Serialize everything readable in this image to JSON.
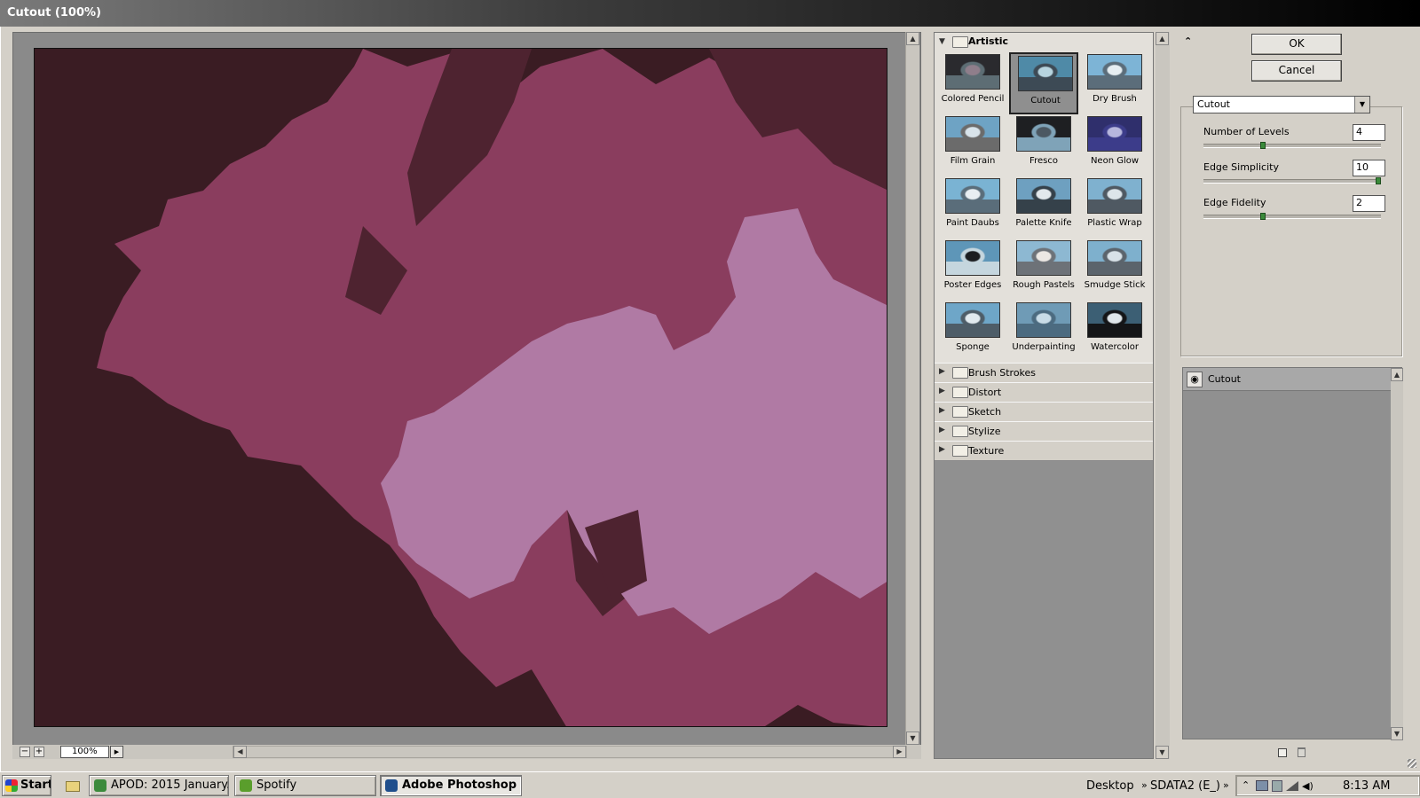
{
  "window": {
    "title": "Cutout (100%)"
  },
  "preview": {
    "zoom": "100%",
    "zoom_out_icon": "minus",
    "zoom_in_icon": "plus",
    "zoom_menu_icon": "triangle-right"
  },
  "gallery": {
    "expanded_category": "Artistic",
    "filters": [
      {
        "label": "Colored Pencil",
        "colors": [
          "#2a2a2e",
          "#8f7e8b",
          "#5d6d74"
        ]
      },
      {
        "label": "Cutout",
        "selected": true,
        "colors": [
          "#4f8aa7",
          "#b7d4df",
          "#3d4a55"
        ]
      },
      {
        "label": "Dry Brush",
        "colors": [
          "#7db4d6",
          "#e6eef2",
          "#5b6d7a"
        ]
      },
      {
        "label": "Film Grain",
        "colors": [
          "#6ea3c4",
          "#d8e3ea",
          "#6b6b6b"
        ]
      },
      {
        "label": "Fresco",
        "colors": [
          "#1e1f22",
          "#4c5862",
          "#7fa3b8"
        ]
      },
      {
        "label": "Neon Glow",
        "colors": [
          "#2f2f6c",
          "#b7b7dd",
          "#3c3c8a"
        ]
      },
      {
        "label": "Paint Daubs",
        "colors": [
          "#7ab3d3",
          "#e8eef2",
          "#5a6d7a"
        ]
      },
      {
        "label": "Palette Knife",
        "colors": [
          "#6ea0c0",
          "#e2e8ec",
          "#35414a"
        ]
      },
      {
        "label": "Plastic Wrap",
        "colors": [
          "#7fb1cf",
          "#dde5ea",
          "#4f5962"
        ]
      },
      {
        "label": "Poster Edges",
        "colors": [
          "#5e96b8",
          "#1b1d20",
          "#c5d6de"
        ]
      },
      {
        "label": "Rough Pastels",
        "colors": [
          "#8db8d2",
          "#ece8e4",
          "#6d7278"
        ]
      },
      {
        "label": "Smudge Stick",
        "colors": [
          "#7eb0cd",
          "#d8e2e8",
          "#5b646c"
        ]
      },
      {
        "label": "Sponge",
        "colors": [
          "#6ea6c8",
          "#e1eaef",
          "#4e5d68"
        ]
      },
      {
        "label": "Underpainting",
        "colors": [
          "#6f9bb6",
          "#c9dce7",
          "#4c6b80"
        ]
      },
      {
        "label": "Watercolor",
        "colors": [
          "#3c5f74",
          "#dfe6ea",
          "#141517"
        ]
      }
    ],
    "categories": [
      "Brush Strokes",
      "Distort",
      "Sketch",
      "Stylize",
      "Texture"
    ]
  },
  "settings": {
    "ok_label": "OK",
    "cancel_label": "Cancel",
    "collapse_icon": "double-chevron-up",
    "selected_filter": "Cutout",
    "params": [
      {
        "label": "Number of Levels",
        "value": "4",
        "position": 0.33
      },
      {
        "label": "Edge Simplicity",
        "value": "10",
        "position": 1.0
      },
      {
        "label": "Edge Fidelity",
        "value": "2",
        "position": 0.33
      }
    ]
  },
  "layers": {
    "items": [
      {
        "label": "Cutout",
        "visible": true
      }
    ],
    "new_layer_icon": "new-effect-layer",
    "delete_icon": "trash"
  },
  "taskbar": {
    "start_label": "Start",
    "tasks": [
      {
        "label": "APOD: 2015 January...",
        "icon_color": "#3b8a3b"
      },
      {
        "label": "Spotify",
        "icon_color": "#5a9e2c"
      },
      {
        "label": "Adobe Photoshop ...",
        "icon_color": "#1f4e8c",
        "active": true
      }
    ],
    "toolbar_desktop": "Desktop",
    "toolbar_drive": "SDATA2 (E_)",
    "clock": "8:13 AM"
  },
  "colors": {
    "preview_dark": "#3a1c23",
    "preview_mid": "#8a3d5e",
    "preview_shadow": "#4e2330",
    "preview_light": "#b07aa4"
  }
}
